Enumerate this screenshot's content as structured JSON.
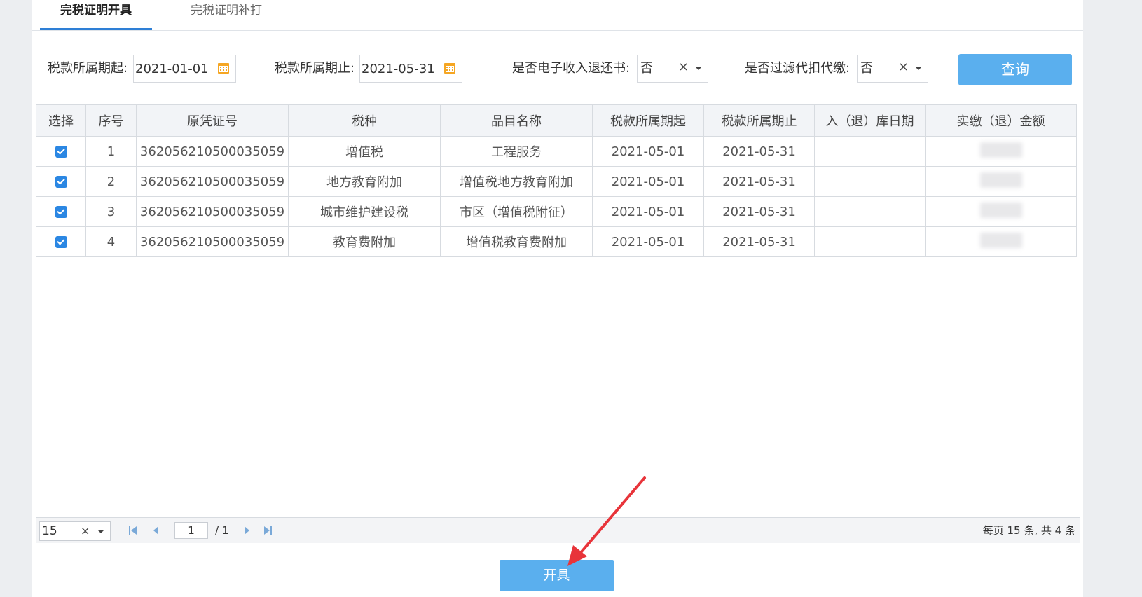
{
  "tabs": [
    {
      "label": "完税证明开具",
      "active": true
    },
    {
      "label": "完税证明补打",
      "active": false
    }
  ],
  "filters": {
    "start_label": "税款所属期起:",
    "start_value": "2021-01-01",
    "end_label": "税款所属期止:",
    "end_value": "2021-05-31",
    "refund_label": "是否电子收入退还书:",
    "refund_value": "否",
    "withhold_label": "是否过滤代扣代缴:",
    "withhold_value": "否",
    "query_button": "查询"
  },
  "table": {
    "headers": [
      "选择",
      "序号",
      "原凭证号",
      "税种",
      "品目名称",
      "税款所属期起",
      "税款所属期止",
      "入（退）库日期",
      "实缴（退）金额"
    ],
    "rows": [
      {
        "checked": true,
        "no": "1",
        "voucher": "362056210500035059",
        "tax": "增值税",
        "item": "工程服务",
        "start": "2021-05-01",
        "end": "2021-05-31",
        "date": "",
        "amount": ""
      },
      {
        "checked": true,
        "no": "2",
        "voucher": "362056210500035059",
        "tax": "地方教育附加",
        "item": "增值税地方教育附加",
        "start": "2021-05-01",
        "end": "2021-05-31",
        "date": "",
        "amount": ""
      },
      {
        "checked": true,
        "no": "3",
        "voucher": "362056210500035059",
        "tax": "城市维护建设税",
        "item": "市区（增值税附征）",
        "start": "2021-05-01",
        "end": "2021-05-31",
        "date": "",
        "amount": ""
      },
      {
        "checked": true,
        "no": "4",
        "voucher": "362056210500035059",
        "tax": "教育费附加",
        "item": "增值税教育费附加",
        "start": "2021-05-01",
        "end": "2021-05-31",
        "date": "",
        "amount": ""
      }
    ]
  },
  "pager": {
    "page_size": "15",
    "current_page": "1",
    "total_pages": "/ 1",
    "info": "每页 15 条, 共 4 条"
  },
  "actions": {
    "issue_button": "开具"
  },
  "colors": {
    "accent": "#2b87e3",
    "button": "#5aafee",
    "arrow": "#e8343a"
  }
}
